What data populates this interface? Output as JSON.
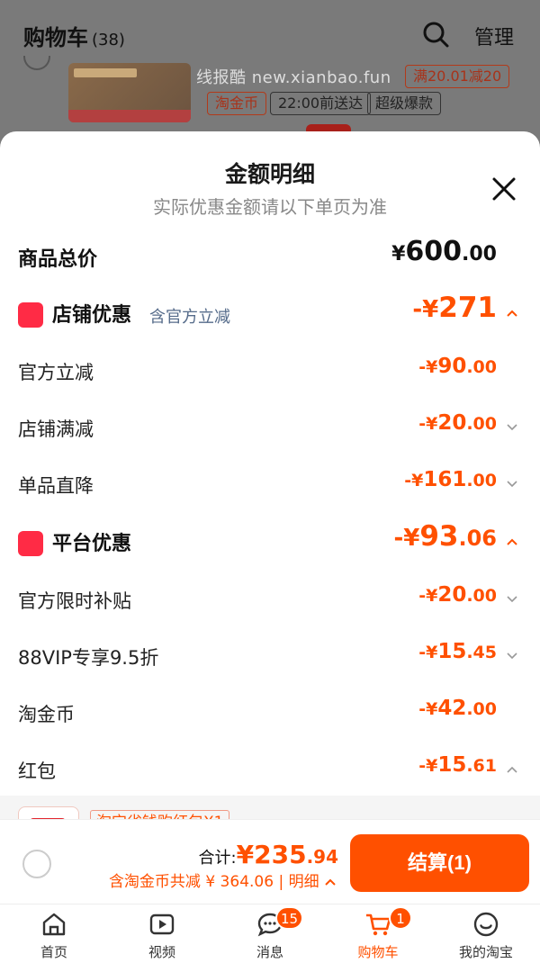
{
  "background": {
    "title": "购物车",
    "count": "(38)",
    "manage": "管理",
    "watermark": "线报酷 new.xianbao.fun",
    "tags": [
      "淘金币",
      "22:00前送达",
      "超级爆款"
    ],
    "promo": "满20.01减20"
  },
  "sheet": {
    "title": "金额明细",
    "subtitle": "实际优惠金额请以下单页为准",
    "total": {
      "label": "商品总价",
      "symbol": "¥",
      "int": "600",
      "dec": ".00"
    },
    "store": {
      "label": "店铺优惠",
      "note": "含官方立减",
      "amount": {
        "sign": "-¥",
        "int": "271",
        "dec": ""
      },
      "items": [
        {
          "label": "官方立减",
          "sign": "-¥",
          "int": "90",
          "dec": ".00",
          "chevron": "none"
        },
        {
          "label": "店铺满减",
          "sign": "-¥",
          "int": "20",
          "dec": ".00",
          "chevron": "down"
        },
        {
          "label": "单品直降",
          "sign": "-¥",
          "int": "161",
          "dec": ".00",
          "chevron": "down"
        }
      ]
    },
    "platform": {
      "label": "平台优惠",
      "amount": {
        "sign": "-¥",
        "int": "93",
        "dec": ".06"
      },
      "items": [
        {
          "label": "官方限时补贴",
          "sign": "-¥",
          "int": "20",
          "dec": ".00",
          "chevron": "down"
        },
        {
          "label": "88VIP专享9.5折",
          "sign": "-¥",
          "int": "15",
          "dec": ".45",
          "chevron": "down"
        },
        {
          "label": "淘金币",
          "sign": "-¥",
          "int": "42",
          "dec": ".00",
          "chevron": "none"
        },
        {
          "label": "红包",
          "sign": "-¥",
          "int": "15",
          "dec": ".61",
          "chevron": "up"
        }
      ]
    },
    "coupon_tag": "淘宝省钱购红包X1"
  },
  "checkout": {
    "sum_label": "合计:",
    "sum_symbol": "¥",
    "sum_int": "235",
    "sum_dec": ".94",
    "detail": "含淘金币共减 ¥ 364.06 | 明细",
    "button": "结算(1)"
  },
  "tabbar": {
    "items": [
      {
        "label": "首页",
        "icon": "home-icon"
      },
      {
        "label": "视频",
        "icon": "video-icon"
      },
      {
        "label": "消息",
        "icon": "message-icon",
        "badge": "15"
      },
      {
        "label": "购物车",
        "icon": "cart-icon",
        "badge": "1"
      },
      {
        "label": "我的淘宝",
        "icon": "profile-icon"
      }
    ]
  },
  "colors": {
    "accent": "#ff5000",
    "store_icon": "#ff2b45",
    "text": "#1a1a1a"
  }
}
